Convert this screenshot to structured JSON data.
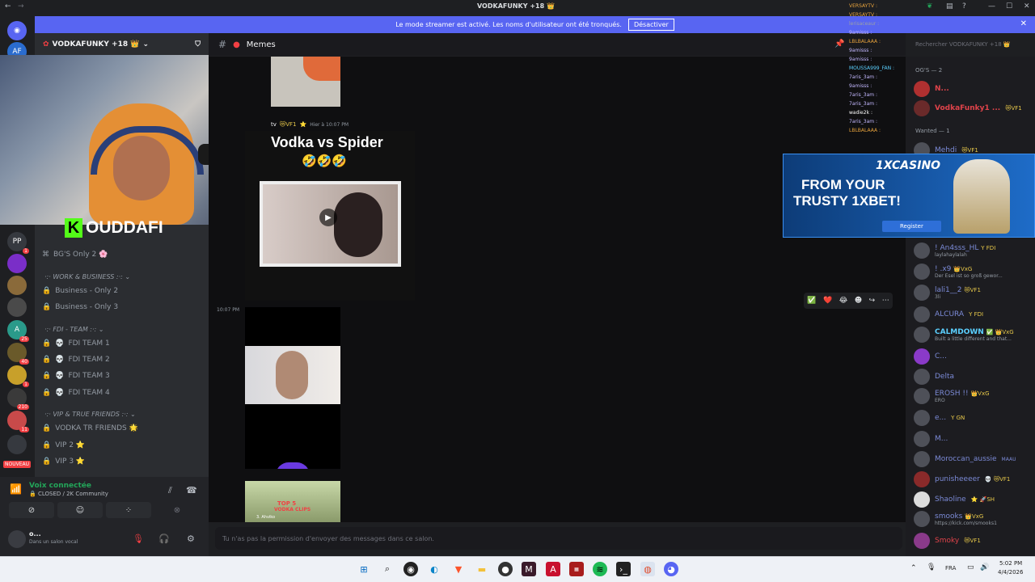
{
  "window": {
    "title": "VODKAFUNKY +18 👑",
    "controls": [
      "—",
      "☐",
      "✕"
    ]
  },
  "banner": {
    "text": "Le mode streamer est activé. Les noms d'utilisateur ont été tronqués.",
    "button": "Désactiver",
    "close": "✕"
  },
  "guild": {
    "name": "VODKAFUNKY +18 👑",
    "invite_icon": "add-member-icon"
  },
  "server_rail": [
    {
      "label": "PP",
      "badge": "1"
    },
    {
      "label": "A",
      "badge": "25"
    },
    {
      "label": "",
      "badge": "40"
    },
    {
      "label": "",
      "badge": "1"
    },
    {
      "label": "",
      "badge": "210"
    },
    {
      "label": "",
      "badge": "11"
    }
  ],
  "server_rail_new": "NOUVEAU",
  "channels": {
    "bgs": "BG'S Only 2 🌸",
    "categories": [
      {
        "name": "WORK & BUSINESS",
        "items": [
          "Business - Only 2",
          "Business - Only 3"
        ]
      },
      {
        "name": "FDI - TEAM",
        "items": [
          "FDI TEAM 1",
          "FDI TEAM 2",
          "FDI TEAM 3",
          "FDI TEAM 4"
        ]
      },
      {
        "name": "VIP & TRUE FRIENDS",
        "items": [
          "VODKA TR FRIENDS 🌟",
          "VIP 2 ⭐",
          "VIP 3 ⭐"
        ]
      }
    ]
  },
  "stream_overlay": {
    "logo_letter": "K",
    "logo_text": "OUDDAFI"
  },
  "channel_header": {
    "hash": "#",
    "name": "Memes",
    "search_placeholder": "Rechercher VODKAFUNKY +18 👑"
  },
  "chat": {
    "author_suffix": "tv",
    "author_tag": "😻VF1",
    "timestamp": "Hier à 10:07 PM",
    "post_title": "Vodka vs Spider",
    "post_emoji": "🤣🤣🤣",
    "side_time": "10:07 PM",
    "clip_title": "TOP 5",
    "clip_sub": "VODKA CLIPS",
    "clip_tag": "3. Ahviko",
    "reactions": [
      "✅",
      "❤️",
      "😂",
      "☻",
      "↪",
      "⋯"
    ]
  },
  "message_bar": {
    "placeholder": "Tu n'as pas la permission d'envoyer des messages dans ce salon."
  },
  "voice_panel": {
    "status": "Voix connectée",
    "channel": "CLOSED / 2K Community",
    "buttons": [
      "⊘",
      "☺",
      "⁘",
      "⊗"
    ]
  },
  "user_panel": {
    "name": "o...",
    "status": "Dans un salon vocal"
  },
  "chat_feed": [
    {
      "name": "VERSAYTV :",
      "color": "#e8a33d"
    },
    {
      "name": "VERSAYTV :",
      "color": "#e8a33d"
    },
    {
      "name": "lerisaceaur :",
      "color": "#9aa0a6"
    },
    {
      "name": "9amisss :",
      "color": "#c3b8ff"
    },
    {
      "name": "LBLBALAAA :",
      "color": "#e8a33d"
    },
    {
      "name": "9amisss :",
      "color": "#c3b8ff"
    },
    {
      "name": "9amisss :",
      "color": "#c3b8ff"
    },
    {
      "name": "MOUSSA999_FAN :",
      "color": "#5bd0ff"
    },
    {
      "name": "7aris_3am :",
      "color": "#c3b8ff"
    },
    {
      "name": "9amisss :",
      "color": "#c3b8ff"
    },
    {
      "name": "7aris_3am :",
      "color": "#c3b8ff"
    },
    {
      "name": "7aris_3am :",
      "color": "#c3b8ff"
    },
    {
      "name": "wadie2k :",
      "color": "#ffffff"
    },
    {
      "name": "7aris_3am :",
      "color": "#c3b8ff"
    },
    {
      "name": "LBLBALAAA :",
      "color": "#e8a33d"
    }
  ],
  "members": {
    "group1": "OG'S — 2",
    "group2": "Wanted — 1",
    "list": [
      {
        "name": "N...",
        "color": "#e0434a",
        "tag": "",
        "sub": ""
      },
      {
        "name": "VodkaFunky1 ...",
        "color": "#e0434a",
        "tag": "😻VF1",
        "sub": ""
      },
      {
        "name": "Mehdi",
        "color": "#7b8ad6",
        "tag": "😻VF1",
        "sub": ""
      },
      {
        "name": "! An4sss_HL",
        "color": "#7b8ad6",
        "tag": "Y FDI",
        "sub": "laylahaylalah"
      },
      {
        "name": "! .x9",
        "color": "#7b8ad6",
        "tag": "👑VxG",
        "sub": "Der Esel ist so groß gewor..."
      },
      {
        "name": "lali1__2",
        "color": "#7b8ad6",
        "tag": "😻VF1",
        "sub": "3li"
      },
      {
        "name": "ALCURA",
        "color": "#7b8ad6",
        "tag": "Y FDI",
        "sub": ""
      },
      {
        "name": "CALMDOWN",
        "color": "#5bd0ff",
        "tag": "✅ 👑VxG",
        "sub": "Built a little different and that..."
      },
      {
        "name": "C...",
        "color": "#7b8ad6",
        "tag": "",
        "sub": ""
      },
      {
        "name": "Delta",
        "color": "#7b8ad6",
        "tag": "",
        "sub": ""
      },
      {
        "name": "EROSH !!",
        "color": "#7b8ad6",
        "tag": "👑VxG",
        "sub": "ERO"
      },
      {
        "name": "e...",
        "color": "#7b8ad6",
        "tag": "Y GN",
        "sub": ""
      },
      {
        "name": "M...",
        "color": "#7b8ad6",
        "tag": "",
        "sub": ""
      },
      {
        "name": "Moroccan_aussie",
        "color": "#7b8ad6",
        "tag": "MAAU",
        "sub": ""
      },
      {
        "name": "punisheeeer",
        "color": "#7b8ad6",
        "tag": "💀 😻VF1",
        "sub": ""
      },
      {
        "name": "Shaoline",
        "color": "#7b8ad6",
        "tag": "⭐ 🚀SH",
        "sub": ""
      },
      {
        "name": "smooks",
        "color": "#7b8ad6",
        "tag": "👑VxG",
        "sub": "https://kick.com/smooks1"
      },
      {
        "name": "Smoky",
        "color": "#e0434a",
        "tag": "😻VF1",
        "sub": ""
      }
    ]
  },
  "ad": {
    "brand": "1XCASINO",
    "headline1": "FROM YOUR",
    "headline2": "TRUSTY 1XBET!",
    "button": "Register"
  },
  "taskbar": {
    "icons": [
      "windows-start-icon",
      "search-icon",
      "obs-icon",
      "edge-icon",
      "brave-icon",
      "folder-icon",
      "app-icon",
      "app-icon-2",
      "acrobat-icon",
      "app-icon-3",
      "spotify-icon",
      "terminal-icon",
      "browser-icon",
      "discord-icon"
    ],
    "lang": "FRA",
    "time": "5:02 PM",
    "date": "4/4/2026",
    "tray": [
      "⌃",
      "🎙",
      "▭",
      "🔊"
    ]
  },
  "colors": {
    "accent": "#5865f2",
    "banner": "#5865f2",
    "sidebar": "#2b2d31",
    "chat_bg": "#0f0f11",
    "kick_green": "#53fc18"
  }
}
